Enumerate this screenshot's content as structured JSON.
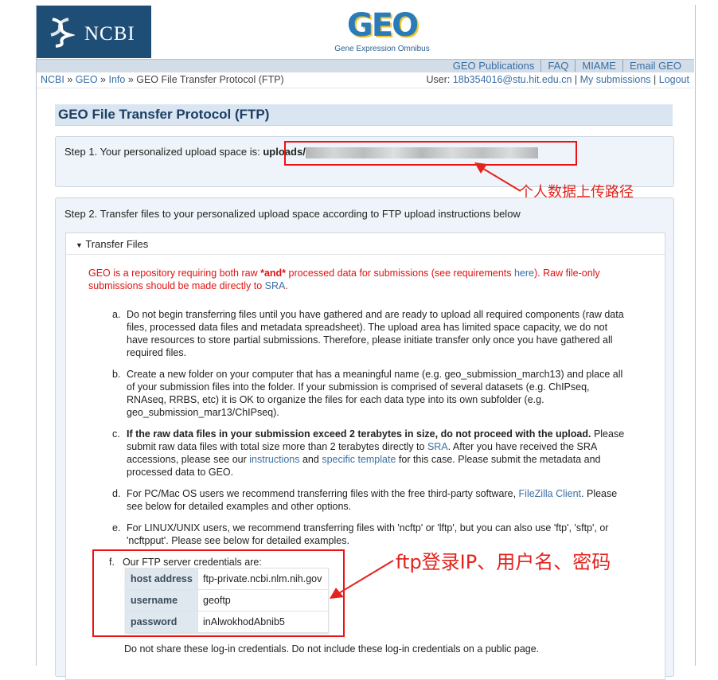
{
  "header": {
    "ncbi_logo": "NCBI",
    "geo_logo": "GEO",
    "geo_subtitle": "Gene Expression Omnibus",
    "nav": [
      "GEO Publications",
      "FAQ",
      "MIAME",
      "Email GEO"
    ]
  },
  "breadcrumb": [
    "NCBI",
    "GEO",
    "Info",
    "GEO File Transfer Protocol (FTP)"
  ],
  "user": {
    "label": "User:",
    "email": "18b354016@stu.hit.edu.cn",
    "submissions": "My submissions",
    "logout": "Logout"
  },
  "page_title": "GEO File Transfer Protocol (FTP)",
  "step1": {
    "label": "Step 1. Your personalized upload space is:",
    "path": "uploads/"
  },
  "annotations": {
    "upload_path": "个人数据上传路径",
    "credentials": "ftp登录IP、用户名、密码"
  },
  "step2": {
    "label": "Step 2. Transfer files to your personalized upload space according to FTP upload instructions below",
    "toggle": "Transfer Files",
    "warn": {
      "t1": "GEO is a repository requiring both raw ",
      "t2": "*and*",
      "t3": " processed data for submissions (see requirements ",
      "here": "here",
      "t4": "). Raw file-only submissions should be made directly to ",
      "sra": "SRA",
      "t5": "."
    },
    "items": [
      {
        "marker": "a.",
        "text": "Do not begin transferring files until you have gathered and are ready to upload all required components (raw data files, processed data files and metadata spreadsheet). The upload area has limited space capacity, we do not have resources to store partial submissions. Therefore, please initiate transfer only once you have gathered all required files."
      },
      {
        "marker": "b.",
        "text": "Create a new folder on your computer that has a meaningful name (e.g. geo_submission_march13) and place all of your submission files into the folder. If your submission is comprised of several datasets (e.g. ChIPseq, RNAseq, RRBS, etc) it is OK to organize the files for each data type into its own subfolder (e.g. geo_submission_mar13/ChIPseq)."
      },
      {
        "marker": "c.",
        "bold": "If the raw data files in your submission exceed 2 terabytes in size, do not proceed with the upload.",
        "t1": " Please submit raw data files with total size more than 2 terabytes directly to ",
        "sra": "SRA",
        "t2": ". After you have received the SRA accessions, please see our ",
        "instructions": "instructions",
        "t3": " and ",
        "template": "specific template",
        "t4": " for this case. Please submit the metadata and processed data to GEO."
      },
      {
        "marker": "d.",
        "t1": "For PC/Mac OS users we recommend transferring files with the free third-party software, ",
        "filezilla": "FileZilla Client",
        "t2": ". Please see below for detailed examples and other options."
      },
      {
        "marker": "e.",
        "text": "For LINUX/UNIX users, we recommend transferring files with 'ncftp' or 'lftp', but you can also use 'ftp', 'sftp', or 'ncftpput'. Please see below for detailed examples."
      },
      {
        "marker": "f.",
        "text": "Our FTP server credentials are:"
      }
    ],
    "credentials": [
      {
        "key": "host address",
        "value": "ftp-private.ncbi.nlm.nih.gov"
      },
      {
        "key": "username",
        "value": "geoftp"
      },
      {
        "key": "password",
        "value": "inAlwokhodAbnib5"
      }
    ],
    "note": "Do not share these log-in credentials. Do not include these log-in credentials on a public page."
  },
  "colors": {
    "annotation_red": "#e4231c",
    "link_blue": "#3b6ea5",
    "ncbi_blue": "#1e4d75"
  }
}
